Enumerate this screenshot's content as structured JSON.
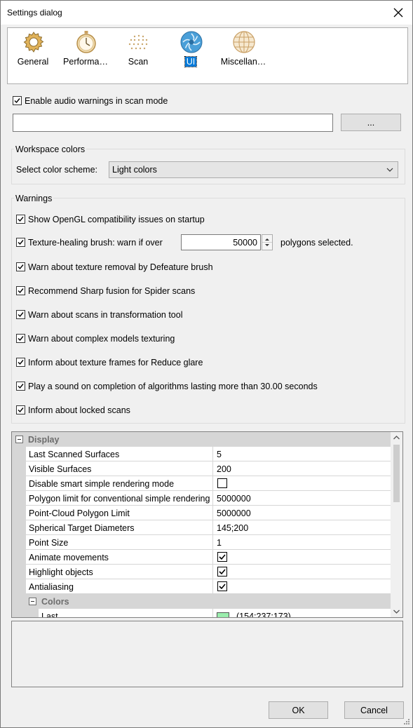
{
  "window": {
    "title": "Settings dialog"
  },
  "tabs": [
    {
      "label": "General",
      "icon": "gear-icon"
    },
    {
      "label": "Performa…",
      "icon": "stopwatch-icon"
    },
    {
      "label": "Scan",
      "icon": "dots-grid-icon"
    },
    {
      "label": "UI",
      "icon": "ui-aperture-icon",
      "active": true
    },
    {
      "label": "Miscellan…",
      "icon": "globe-icon"
    }
  ],
  "audio": {
    "label": "Enable audio warnings in scan mode",
    "checked": true,
    "path_value": "",
    "browse_label": "..."
  },
  "workspace": {
    "group_label": "Workspace colors",
    "scheme_label": "Select color scheme:",
    "scheme_value": "Light colors"
  },
  "warnings": {
    "group_label": "Warnings",
    "items": [
      {
        "label": "Show OpenGL compatibility issues on startup",
        "checked": true
      },
      {
        "label": "Texture-healing brush: warn if over",
        "checked": true
      },
      {
        "label": "Warn about texture removal by Defeature brush",
        "checked": true
      },
      {
        "label": "Recommend Sharp fusion for Spider scans",
        "checked": true
      },
      {
        "label": "Warn about scans in transformation tool",
        "checked": true
      },
      {
        "label": "Warn about complex models texturing",
        "checked": true
      },
      {
        "label": "Inform about texture frames for Reduce glare",
        "checked": true
      },
      {
        "label": "Play a sound on completion of algorithms lasting more than 30.00 seconds",
        "checked": true
      },
      {
        "label": "Inform about locked scans",
        "checked": true
      }
    ],
    "polygon_count": "50000",
    "polygon_suffix": "polygons selected."
  },
  "grid": {
    "display_category": "Display",
    "rows": [
      {
        "name": "Last Scanned Surfaces",
        "value": "5"
      },
      {
        "name": "Visible Surfaces",
        "value": "200"
      },
      {
        "name": "Disable smart simple rendering mode",
        "value": "",
        "checkbox": false
      },
      {
        "name": "Polygon limit for conventional simple rendering",
        "value": "5000000"
      },
      {
        "name": "Point-Cloud Polygon Limit",
        "value": "5000000"
      },
      {
        "name": "Spherical Target Diameters",
        "value": "145;200"
      },
      {
        "name": "Point Size",
        "value": "1"
      },
      {
        "name": "Animate movements",
        "value": "",
        "checkbox": true
      },
      {
        "name": "Highlight objects",
        "value": "",
        "checkbox": true
      },
      {
        "name": "Antialiasing",
        "value": "",
        "checkbox": true
      }
    ],
    "colors_category": "Colors",
    "color_row": {
      "name": "Last",
      "value": "(154;237;173)",
      "swatch": "#9aedad"
    }
  },
  "buttons": {
    "ok": "OK",
    "cancel": "Cancel"
  }
}
